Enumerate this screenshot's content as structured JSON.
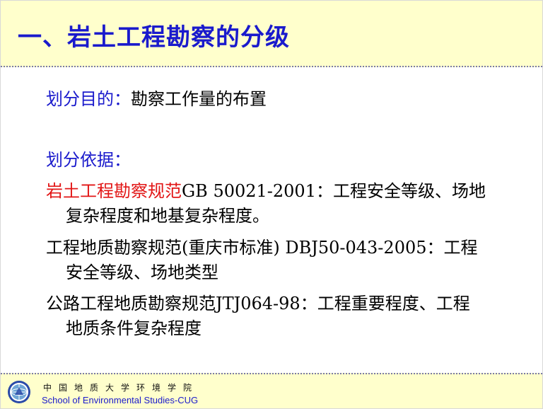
{
  "title": "一、岩土工程勘察的分级",
  "purpose": {
    "label": "划分目的：",
    "text": "勘察工作量的布置"
  },
  "basis": {
    "label": "划分依据："
  },
  "standards": [
    {
      "name": "岩土工程勘察规范",
      "line1": "GB 50021-2001：工程安全等级、场地",
      "line2": "复杂程度和地基复杂程度。"
    },
    {
      "line1": "工程地质勘察规范(重庆市标准) DBJ50-043-2005：工程",
      "line2": "安全等级、场地类型"
    },
    {
      "line1": "公路工程地质勘察规范JTJ064-98：工程重要程度、工程",
      "line2": "地质条件复杂程度"
    }
  ],
  "footer": {
    "cn": "中国地质大学环境学院",
    "en": "School of Environmental Studies-CUG"
  },
  "colors": {
    "title_blue": "#1a1acc",
    "highlight_red": "#e21616",
    "band_yellow": "#ffffcc"
  }
}
